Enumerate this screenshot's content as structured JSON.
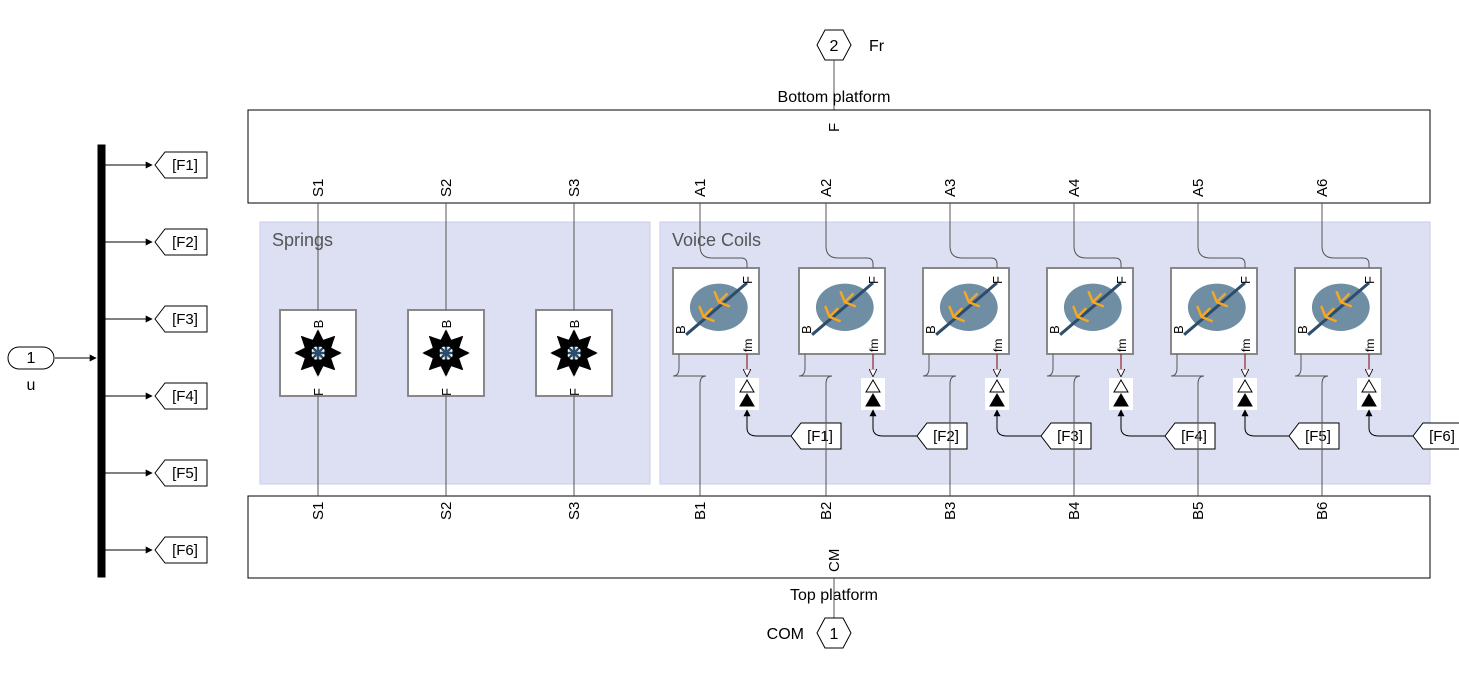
{
  "input": {
    "port_num": "1",
    "label": "u"
  },
  "output_top": {
    "port_num": "2",
    "label": "Fr"
  },
  "output_bottom": {
    "port_num": "1",
    "label": "COM"
  },
  "demux_tags": [
    "[F1]",
    "[F2]",
    "[F3]",
    "[F4]",
    "[F5]",
    "[F6]"
  ],
  "bottom_platform": {
    "title": "Bottom platform",
    "main_port": "F",
    "ports": [
      "S1",
      "S2",
      "S3",
      "A1",
      "A2",
      "A3",
      "A4",
      "A5",
      "A6"
    ]
  },
  "top_platform": {
    "title": "Top platform",
    "main_port": "CM",
    "ports": [
      "S1",
      "S2",
      "S3",
      "B1",
      "B2",
      "B3",
      "B4",
      "B5",
      "B6"
    ]
  },
  "springs": {
    "title": "Springs",
    "items": [
      {
        "top": "B",
        "bot": "F"
      },
      {
        "top": "B",
        "bot": "F"
      },
      {
        "top": "B",
        "bot": "F"
      }
    ]
  },
  "voice_coils": {
    "title": "Voice Coils",
    "items": [
      {
        "top": "F",
        "left": "B",
        "bot": "fm",
        "tag": "[F1]"
      },
      {
        "top": "F",
        "left": "B",
        "bot": "fm",
        "tag": "[F2]"
      },
      {
        "top": "F",
        "left": "B",
        "bot": "fm",
        "tag": "[F3]"
      },
      {
        "top": "F",
        "left": "B",
        "bot": "fm",
        "tag": "[F4]"
      },
      {
        "top": "F",
        "left": "B",
        "bot": "fm",
        "tag": "[F5]"
      },
      {
        "top": "F",
        "left": "B",
        "bot": "fm",
        "tag": "[F6]"
      }
    ]
  }
}
